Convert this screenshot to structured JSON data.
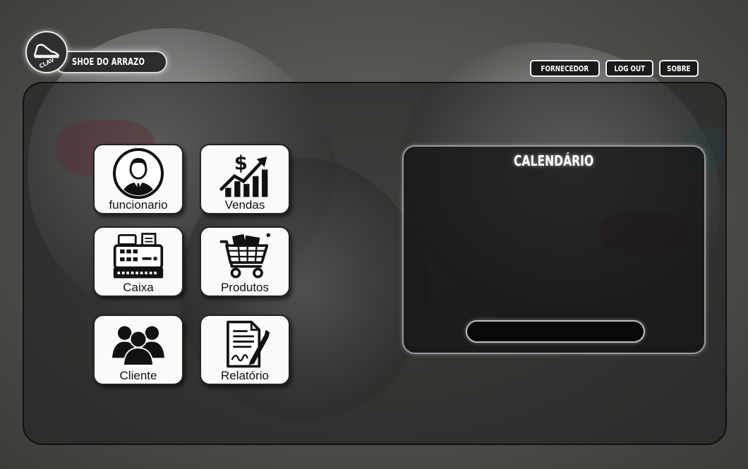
{
  "header": {
    "brand_name": "SHOE DO ARRAZO",
    "logo_text": "CLAV",
    "nav": [
      {
        "label": "FORNECEDOR"
      },
      {
        "label": "LOG OUT"
      },
      {
        "label": "SOBRE"
      }
    ]
  },
  "menu": {
    "tiles": [
      {
        "label": "funcionario",
        "icon": "employee-icon"
      },
      {
        "label": "Vendas",
        "icon": "sales-chart-icon"
      },
      {
        "label": "Caixa",
        "icon": "cash-register-icon"
      },
      {
        "label": "Produtos",
        "icon": "shopping-cart-icon"
      },
      {
        "label": "Cliente",
        "icon": "customers-icon"
      },
      {
        "label": "Relatório",
        "icon": "report-icon"
      }
    ]
  },
  "calendar": {
    "title": "CALENDÁRIO",
    "input_value": ""
  }
}
